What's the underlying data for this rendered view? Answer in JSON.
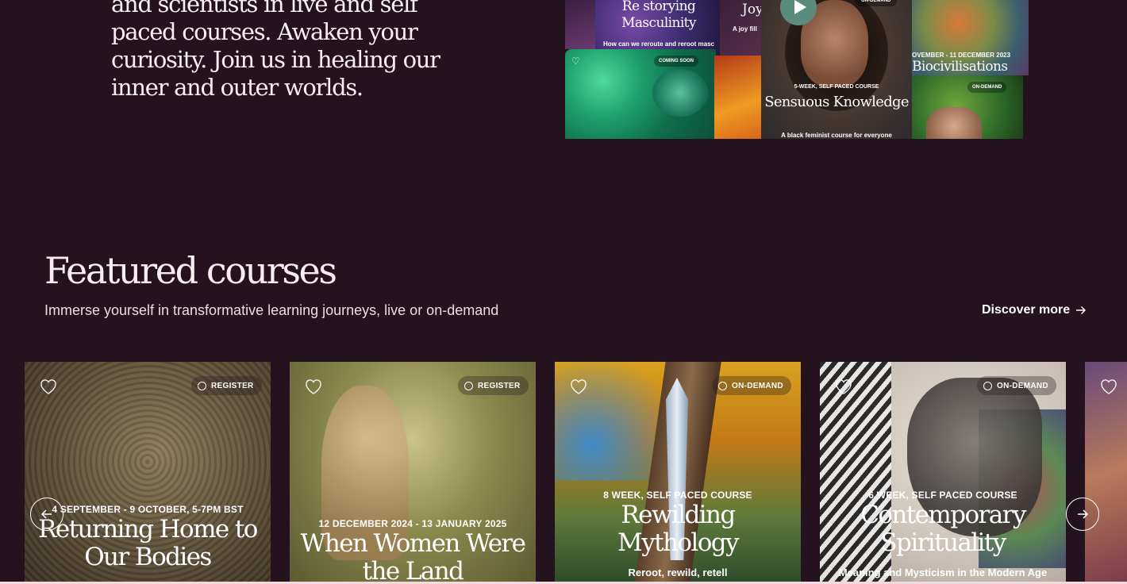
{
  "intro": {
    "text": "and scientists in live and self paced courses. Awaken your curiosity. Join us in healing our inner and outer worlds."
  },
  "collage": {
    "masculinity": {
      "title": "Re storying Masculinity",
      "subtitle": "How can we reroute and reroot masc"
    },
    "joy": {
      "title": "Joy",
      "subtitle": "A joy fill"
    },
    "coming_soon": "COMING SOON",
    "sensuous": {
      "status": "ON-DEMAND",
      "kicker": "5-WEEK, SELF PACED COURSE",
      "title": "Sensuous Knowledge",
      "subtitle": "A black feminist course for everyone"
    },
    "biocivilisations": {
      "date": "OVEMBER - 11 DECEMBER 2023",
      "title": "Biocivilisations",
      "status": "ON-DEMAND"
    }
  },
  "featured": {
    "title": "Featured courses",
    "subtitle": "Immerse yourself in transformative learning journeys, live or on-demand",
    "discover_label": "Discover more"
  },
  "cards": [
    {
      "status": "REGISTER",
      "kicker": "4 SEPTEMBER - 9 OCTOBER, 5-7PM BST",
      "title": "Returning Home to Our Bodies",
      "tagline": ""
    },
    {
      "status": "REGISTER",
      "kicker": "12 DECEMBER 2024 - 13 JANUARY 2025",
      "title": "When Women Were the Land",
      "tagline": ""
    },
    {
      "status": "ON-DEMAND",
      "kicker": "8 WEEK, SELF PACED COURSE",
      "title": "Rewilding Mythology",
      "tagline": "Reroot, rewild, retell"
    },
    {
      "status": "ON-DEMAND",
      "kicker": "6 WEEK, SELF PACED COURSE",
      "title": "Contemporary Spirituality",
      "tagline": "Meaning and Mysticism in the Modern Age"
    }
  ],
  "colors": {
    "background": "#24131f",
    "text": "#f6eef0"
  },
  "icons": {
    "heart": "heart-icon",
    "prev": "arrow-left-icon",
    "next": "arrow-right-icon",
    "play": "play-icon"
  }
}
